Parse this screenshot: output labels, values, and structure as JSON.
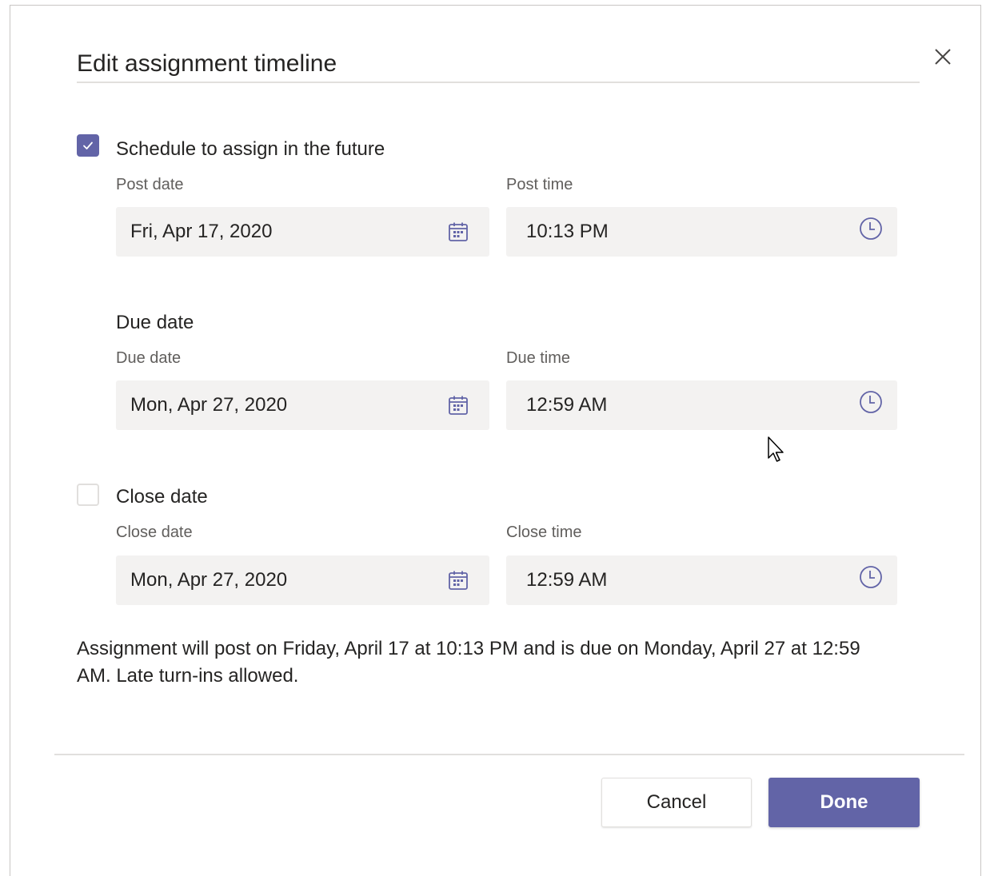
{
  "dialog": {
    "title": "Edit assignment timeline",
    "close_icon": "close-icon"
  },
  "schedule": {
    "checked": true,
    "label": "Schedule to assign in the future",
    "post_date_label": "Post date",
    "post_date_value": "Fri, Apr 17, 2020",
    "post_time_label": "Post time",
    "post_time_value": "10:13 PM"
  },
  "due": {
    "section_label": "Due date",
    "due_date_label": "Due date",
    "due_date_value": "Mon, Apr 27, 2020",
    "due_time_label": "Due time",
    "due_time_value": "12:59 AM"
  },
  "close": {
    "checked": false,
    "label": "Close date",
    "close_date_label": "Close date",
    "close_date_value": "Mon, Apr 27, 2020",
    "close_time_label": "Close time",
    "close_time_value": "12:59 AM"
  },
  "summary": "Assignment will post on Friday, April 17 at 10:13 PM and is due on Monday, April 27 at 12:59 AM. Late turn-ins allowed.",
  "footer": {
    "cancel_label": "Cancel",
    "done_label": "Done"
  },
  "colors": {
    "accent": "#6264a7",
    "field_bg": "#f3f2f1",
    "divider": "#e1dfdd"
  },
  "icons": {
    "date": "calendar-icon",
    "time": "clock-icon",
    "check": "checkmark-icon",
    "pointer": "mouse-pointer-icon"
  }
}
